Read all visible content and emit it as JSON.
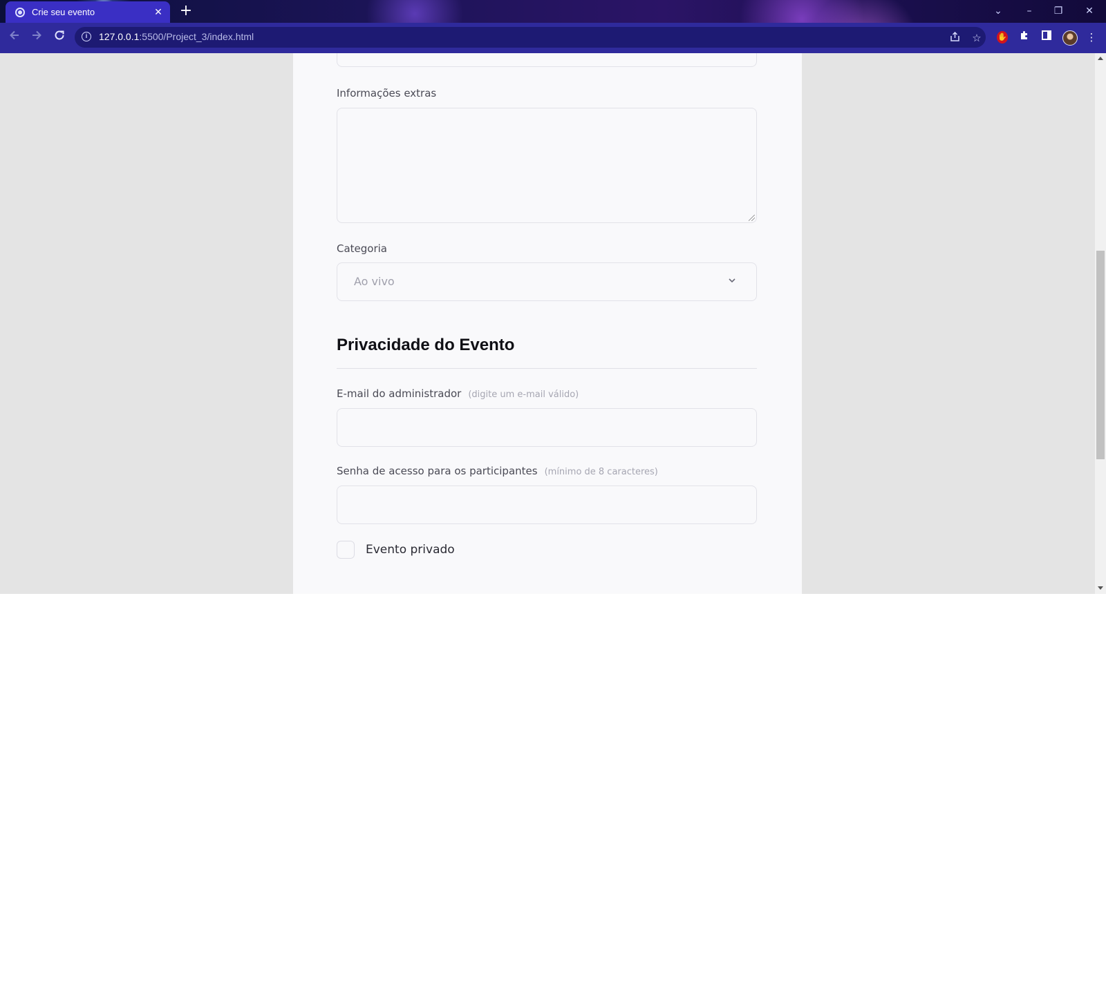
{
  "browser": {
    "tab_title": "Crie seu evento",
    "tab_close": "✕",
    "new_tab": "+",
    "url_host": "127.0.0.1",
    "url_rest": ":5500/Project_3/index.html",
    "window_controls": {
      "dropdown": "⌄",
      "minimize": "–",
      "restore": "❐",
      "close": "✕"
    }
  },
  "form": {
    "extras_label": "Informações extras",
    "extras_value": "",
    "category_label": "Categoria",
    "category_selected": "Ao vivo",
    "privacy_title": "Privacidade do Evento",
    "admin_email_label": "E-mail do administrador",
    "admin_email_hint": "(digite um e-mail válido)",
    "admin_email_value": "",
    "password_label": "Senha de acesso para os participantes",
    "password_hint": "(mínimo de 8 caracteres)",
    "password_value": "",
    "private_label": "Evento privado",
    "private_checked": false
  }
}
